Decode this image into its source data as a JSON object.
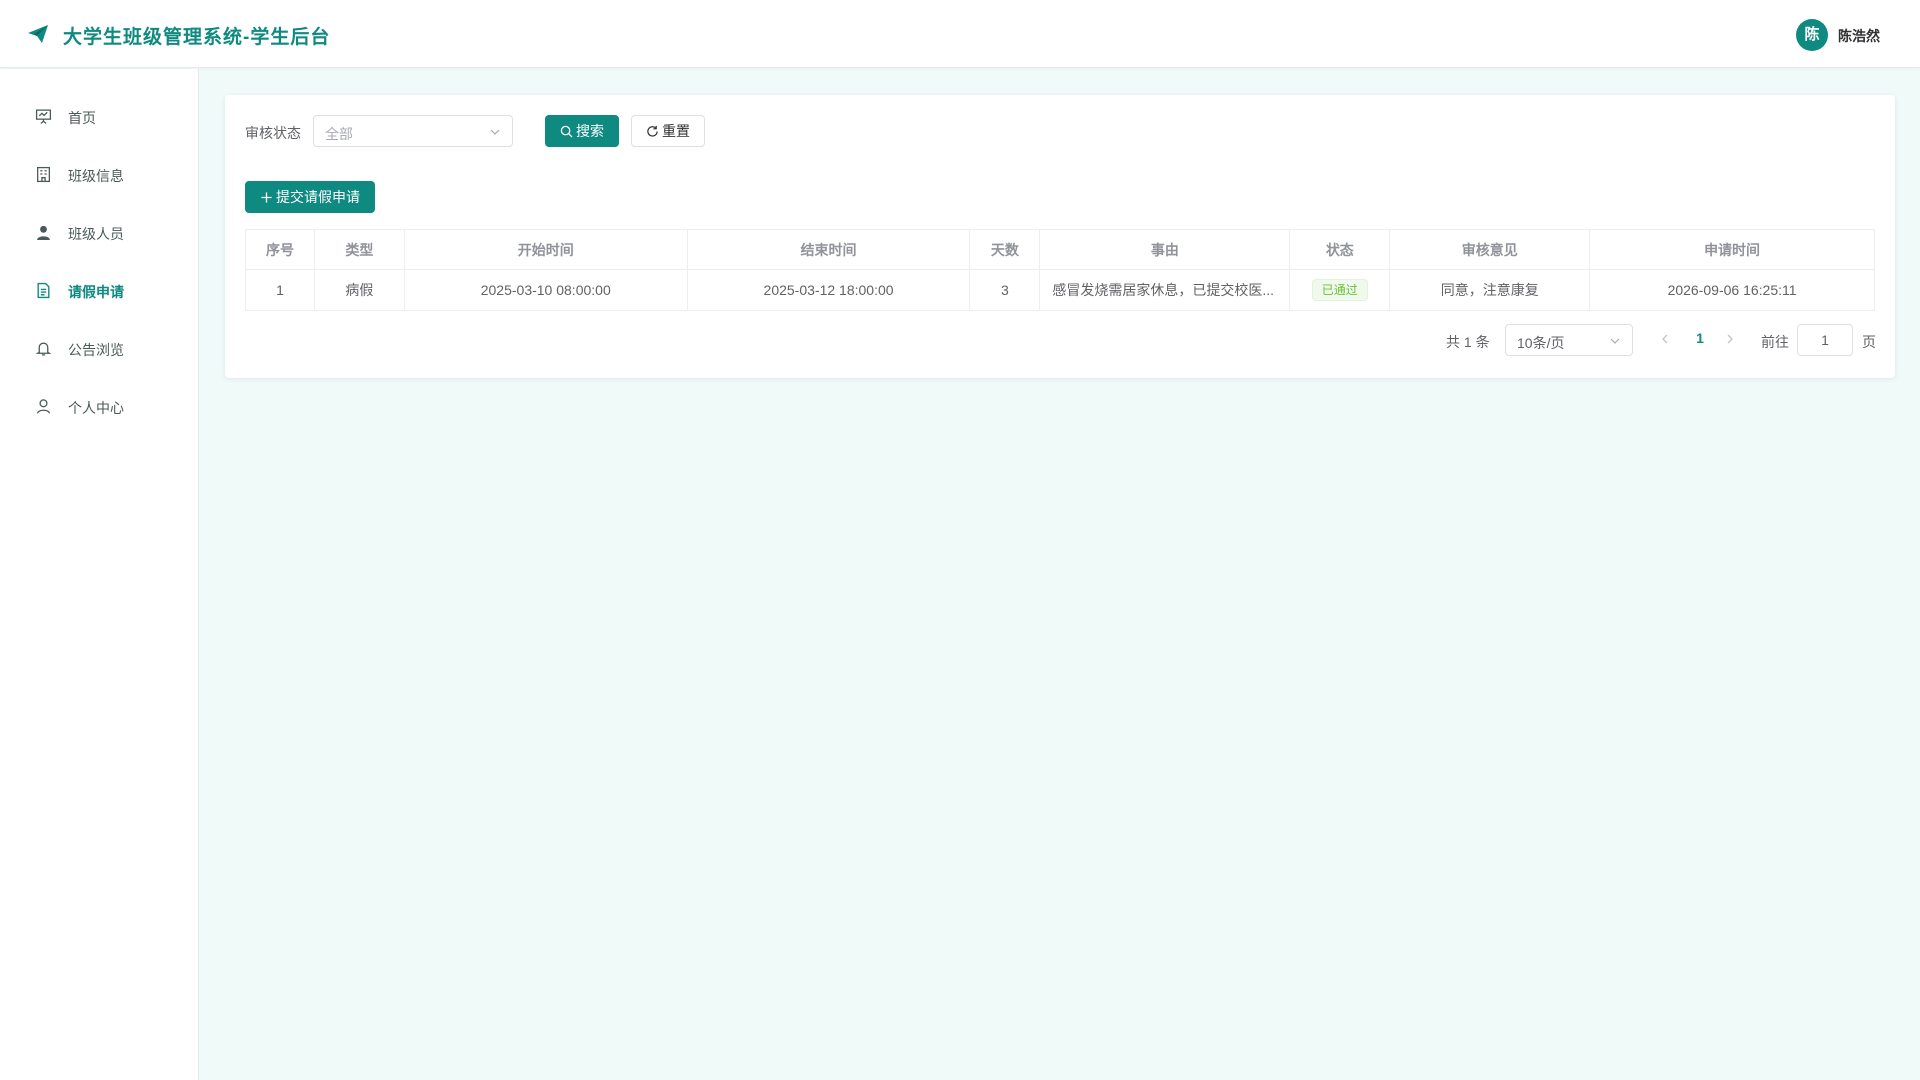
{
  "header": {
    "app_title": "大学生班级管理系统-学生后台",
    "avatar_text": "陈",
    "username": "陈浩然"
  },
  "sidebar": {
    "items": [
      {
        "label": "首页",
        "icon": "presentation-icon",
        "active": false
      },
      {
        "label": "班级信息",
        "icon": "building-icon",
        "active": false
      },
      {
        "label": "班级人员",
        "icon": "user-filled-icon",
        "active": false
      },
      {
        "label": "请假申请",
        "icon": "document-icon",
        "active": true
      },
      {
        "label": "公告浏览",
        "icon": "bell-icon",
        "active": false
      },
      {
        "label": "个人中心",
        "icon": "user-icon",
        "active": false
      }
    ]
  },
  "filter": {
    "label": "审核状态",
    "select_value": "全部",
    "search_label": "搜索",
    "reset_label": "重置"
  },
  "actions": {
    "submit_label": "提交请假申请"
  },
  "table": {
    "columns": [
      "序号",
      "类型",
      "开始时间",
      "结束时间",
      "天数",
      "事由",
      "状态",
      "审核意见",
      "申请时间"
    ],
    "rows": [
      {
        "index": "1",
        "type": "病假",
        "start": "2025-03-10 08:00:00",
        "end": "2025-03-12 18:00:00",
        "days": "3",
        "reason": "感冒发烧需居家休息，已提交校医...",
        "status": "已通过",
        "opinion": "同意，注意康复",
        "applied_at": "2026-09-06 16:25:11"
      }
    ]
  },
  "pagination": {
    "total_text": "共 1 条",
    "page_size": "10条/页",
    "current_page": "1",
    "goto_label": "前往",
    "goto_value": "1",
    "page_suffix": "页"
  },
  "colors": {
    "primary": "#0f8a80",
    "success": "#67c23a",
    "background": "#f0faf9"
  }
}
